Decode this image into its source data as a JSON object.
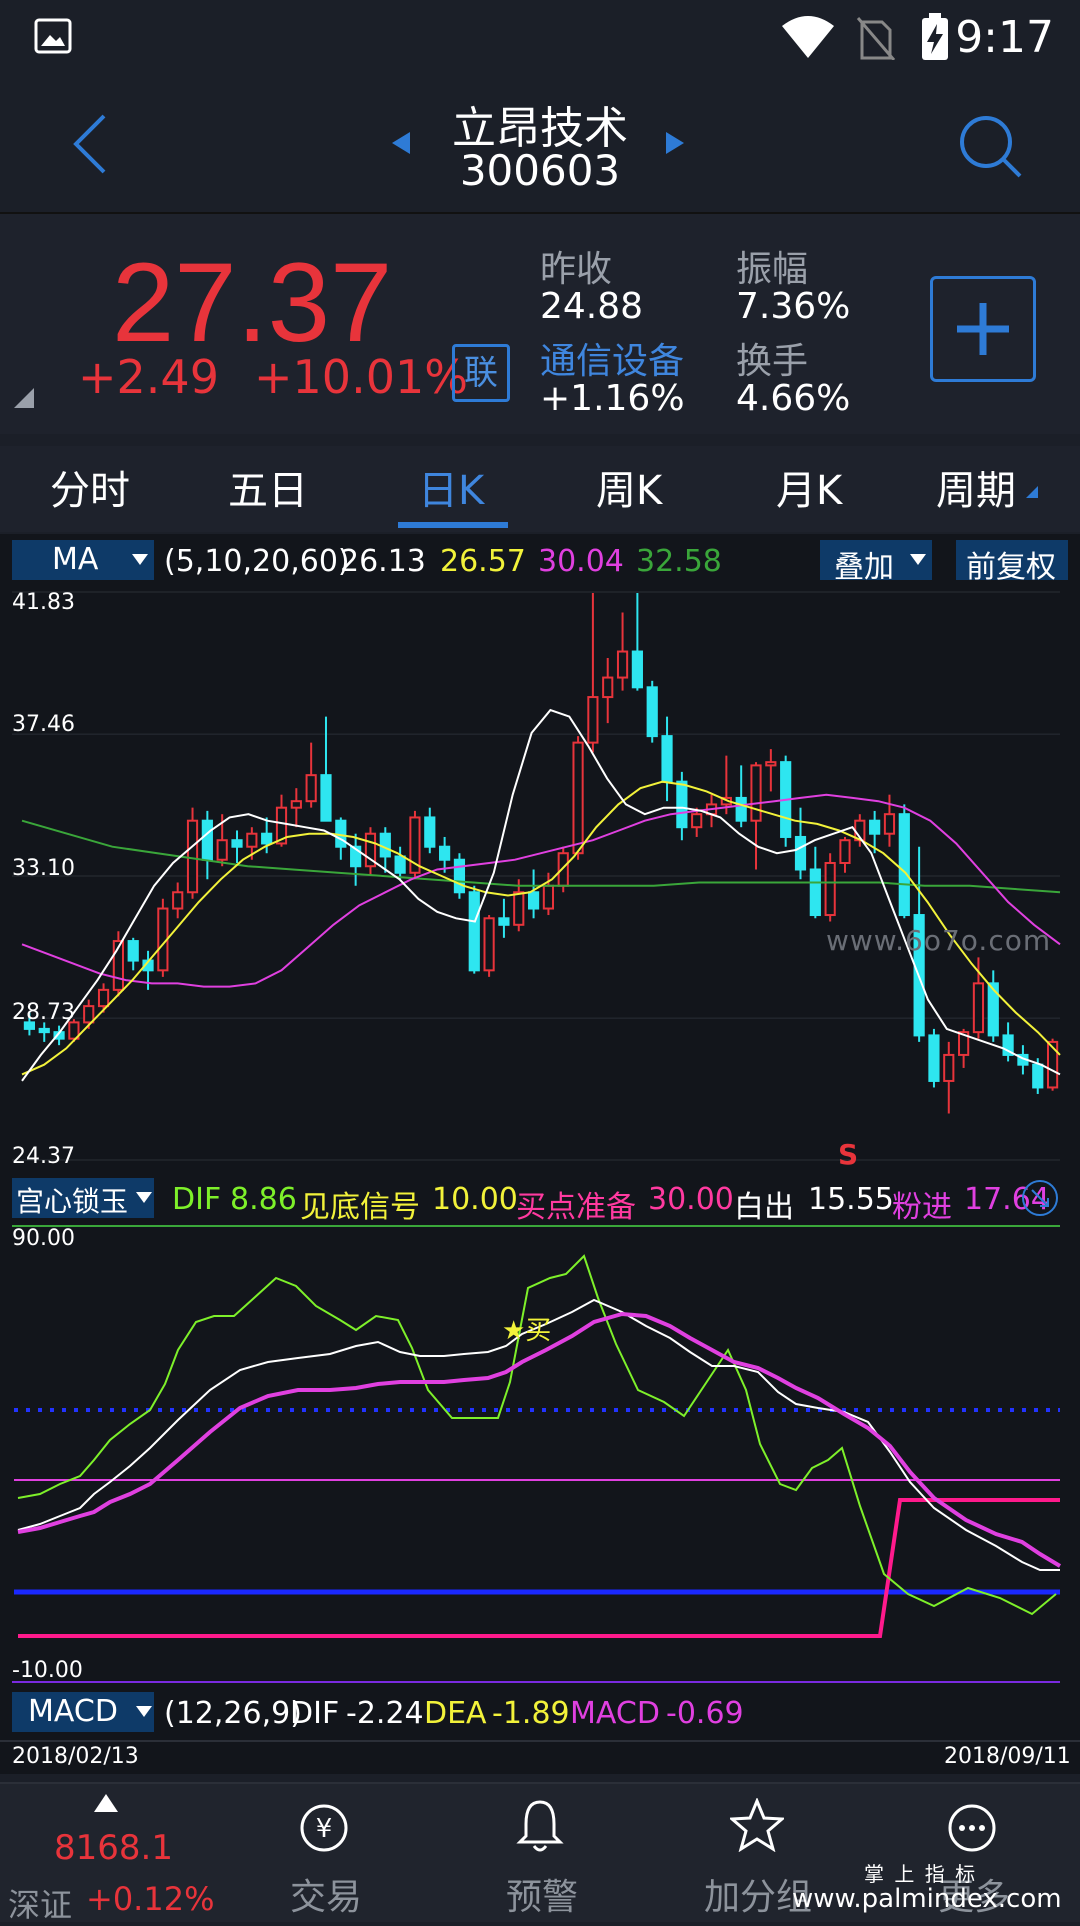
{
  "status": {
    "time": "9:17"
  },
  "header": {
    "stock_name": "立昂技术",
    "stock_code": "300603"
  },
  "quote": {
    "price": "27.37",
    "change": "+2.49",
    "change_pct": "+10.01%",
    "lian_label": "联",
    "prev_close_label": "昨收",
    "prev_close": "24.88",
    "amplitude_label": "振幅",
    "amplitude": "7.36%",
    "sector_label": "通信设备",
    "sector_change": "+1.16%",
    "turnover_label": "换手",
    "turnover": "4.66%"
  },
  "tabs": [
    "分时",
    "五日",
    "日K",
    "周K",
    "月K",
    "周期"
  ],
  "ma_bar": {
    "selector": "MA",
    "params": "(5,10,20,60)",
    "v1": "26.13",
    "v2": "26.57",
    "v3": "30.04",
    "v4": "32.58",
    "overlay_btn": "叠加",
    "adjust_btn": "前复权"
  },
  "price_axis": {
    "max": "41.83",
    "t2": "37.46",
    "t3": "33.10",
    "t4": "28.73",
    "min": "24.37"
  },
  "sell_marker": "S",
  "watermark": "www.6o7o.com",
  "ind_bar": {
    "selector": "宫心锁玉",
    "dif_label": "DIF",
    "dif_val": "8.86",
    "l2_label": "见底信号",
    "l2_val": "10.00",
    "l3_label": "买点准备",
    "l3_val": "30.00",
    "l4_label": "白出",
    "l4_val": "15.55",
    "l5_label": "粉进",
    "l5_val": "17.64"
  },
  "ind_axis": {
    "max": "90.00",
    "min": "-10.00"
  },
  "buy_marker": "★买",
  "macd_bar": {
    "selector": "MACD",
    "params": "(12,26,9)",
    "dif_label": "DIF",
    "dif_val": "-2.24",
    "dea_label": "DEA",
    "dea_val": "-1.89",
    "macd_label": "MACD",
    "macd_val": "-0.69"
  },
  "date_start": "2018/02/13",
  "date_end": "2018/09/11",
  "bottom_nav": {
    "index_value": "8168.1",
    "index_name": "深证",
    "index_change": "+0.12%",
    "trade": "交易",
    "alert": "预警",
    "group": "加分组",
    "more": "更多",
    "brand": "掌 上 指 标",
    "brand_url": "www.palmindex.com"
  },
  "colors": {
    "up": "#e8343b",
    "down": "#2ee6f0",
    "ma5": "#ffffff",
    "ma10": "#f2f23a",
    "ma20": "#e040e0",
    "ma60": "#3aa63a",
    "accent": "#2e7bd6"
  },
  "chart_data": {
    "type": "candlestick",
    "ylim": [
      24.37,
      41.83
    ],
    "candles": [
      [
        28.6,
        28.9,
        28.2,
        28.4
      ],
      [
        28.4,
        28.6,
        28.0,
        28.3
      ],
      [
        28.3,
        28.5,
        27.9,
        28.1
      ],
      [
        28.1,
        28.7,
        28.0,
        28.6
      ],
      [
        28.6,
        29.3,
        28.4,
        29.1
      ],
      [
        29.1,
        29.8,
        28.9,
        29.6
      ],
      [
        29.6,
        31.4,
        29.4,
        31.1
      ],
      [
        31.1,
        31.2,
        30.2,
        30.5
      ],
      [
        30.5,
        30.8,
        29.6,
        30.2
      ],
      [
        30.2,
        32.4,
        30.0,
        32.1
      ],
      [
        32.1,
        32.9,
        31.8,
        32.6
      ],
      [
        32.6,
        35.2,
        32.4,
        34.8
      ],
      [
        34.8,
        35.1,
        33.0,
        33.6
      ],
      [
        33.6,
        35.0,
        33.4,
        34.2
      ],
      [
        34.2,
        34.5,
        33.5,
        34.0
      ],
      [
        34.0,
        34.6,
        33.6,
        34.4
      ],
      [
        34.4,
        34.9,
        33.8,
        34.1
      ],
      [
        34.1,
        35.6,
        34.0,
        35.2
      ],
      [
        35.2,
        35.8,
        34.6,
        35.4
      ],
      [
        35.4,
        37.2,
        35.2,
        36.2
      ],
      [
        36.2,
        38.0,
        34.8,
        34.8
      ],
      [
        34.8,
        34.9,
        33.6,
        34.0
      ],
      [
        34.0,
        34.4,
        32.8,
        33.4
      ],
      [
        33.4,
        34.6,
        33.1,
        34.4
      ],
      [
        34.4,
        34.6,
        33.2,
        33.7
      ],
      [
        33.7,
        34.0,
        33.0,
        33.2
      ],
      [
        33.2,
        35.1,
        33.0,
        34.9
      ],
      [
        34.9,
        35.2,
        33.8,
        34.0
      ],
      [
        34.0,
        34.3,
        33.2,
        33.6
      ],
      [
        33.6,
        33.8,
        32.4,
        32.6
      ],
      [
        32.6,
        32.8,
        30.1,
        30.2
      ],
      [
        30.2,
        31.9,
        30.0,
        31.8
      ],
      [
        31.8,
        32.4,
        31.2,
        31.6
      ],
      [
        31.6,
        33.0,
        31.4,
        32.6
      ],
      [
        32.6,
        33.3,
        31.8,
        32.1
      ],
      [
        32.1,
        33.2,
        31.9,
        32.8
      ],
      [
        32.8,
        34.0,
        32.6,
        33.8
      ],
      [
        33.8,
        37.4,
        33.6,
        37.2
      ],
      [
        37.2,
        41.8,
        36.9,
        38.6
      ],
      [
        38.6,
        39.8,
        37.8,
        39.2
      ],
      [
        39.2,
        41.2,
        38.8,
        40.0
      ],
      [
        40.0,
        41.8,
        38.8,
        38.9
      ],
      [
        38.9,
        39.1,
        37.2,
        37.4
      ],
      [
        37.4,
        38.0,
        35.4,
        36.0
      ],
      [
        36.0,
        36.3,
        34.2,
        34.6
      ],
      [
        34.6,
        35.2,
        34.3,
        35.0
      ],
      [
        35.0,
        35.6,
        34.6,
        35.3
      ],
      [
        35.3,
        36.8,
        35.0,
        35.5
      ],
      [
        35.5,
        36.5,
        34.6,
        34.8
      ],
      [
        34.8,
        36.6,
        33.3,
        36.5
      ],
      [
        36.5,
        37.0,
        35.7,
        36.6
      ],
      [
        36.6,
        36.8,
        34.0,
        34.3
      ],
      [
        34.3,
        35.2,
        33.0,
        33.3
      ],
      [
        33.3,
        34.0,
        31.8,
        31.9
      ],
      [
        31.9,
        33.8,
        31.7,
        33.5
      ],
      [
        33.5,
        34.3,
        33.2,
        34.2
      ],
      [
        34.2,
        35.0,
        34.0,
        34.8
      ],
      [
        34.8,
        35.1,
        33.8,
        34.4
      ],
      [
        34.4,
        35.6,
        34.0,
        35.0
      ],
      [
        35.0,
        35.3,
        31.8,
        31.9
      ],
      [
        31.9,
        34.0,
        28.0,
        28.2
      ],
      [
        28.2,
        28.4,
        26.6,
        26.8
      ],
      [
        26.8,
        28.0,
        25.8,
        27.6
      ],
      [
        27.6,
        28.4,
        27.2,
        28.3
      ],
      [
        28.3,
        30.6,
        28.1,
        29.8
      ],
      [
        29.8,
        30.2,
        28.0,
        28.2
      ],
      [
        28.2,
        28.6,
        27.4,
        27.6
      ],
      [
        27.6,
        27.9,
        27.0,
        27.3
      ],
      [
        27.3,
        27.5,
        26.4,
        26.6
      ],
      [
        26.6,
        28.1,
        26.5,
        28.0
      ]
    ],
    "ma5": [
      26.8,
      27.6,
      28.3,
      29.1,
      29.9,
      30.8,
      31.8,
      32.8,
      33.5,
      34.0,
      34.5,
      34.9,
      35.0,
      34.8,
      34.7,
      34.6,
      34.5,
      34.2,
      33.8,
      33.4,
      33.0,
      32.4,
      32.0,
      31.8,
      31.7,
      33.2,
      35.6,
      37.5,
      38.2,
      38.0,
      37.1,
      36.1,
      35.3,
      35.0,
      35.2,
      35.2,
      35.1,
      34.9,
      34.4,
      34.0,
      33.8,
      33.9,
      34.2,
      34.4,
      34.6,
      33.8,
      32.3,
      30.8,
      29.3,
      28.4,
      28.2,
      28.0,
      27.8,
      27.5,
      27.3,
      27.0
    ],
    "ma10": [
      27.0,
      27.3,
      27.8,
      28.5,
      29.2,
      29.9,
      30.7,
      31.5,
      32.3,
      33.0,
      33.6,
      34.0,
      34.3,
      34.4,
      34.4,
      34.3,
      34.1,
      33.8,
      33.4,
      33.1,
      32.8,
      32.6,
      32.5,
      32.6,
      33.0,
      33.7,
      34.6,
      35.3,
      35.8,
      36.0,
      35.9,
      35.7,
      35.4,
      35.2,
      35.0,
      34.8,
      34.7,
      34.5,
      34.2,
      33.8,
      33.2,
      32.3,
      31.3,
      30.4,
      29.6,
      28.9,
      28.3,
      27.6
    ]
  }
}
